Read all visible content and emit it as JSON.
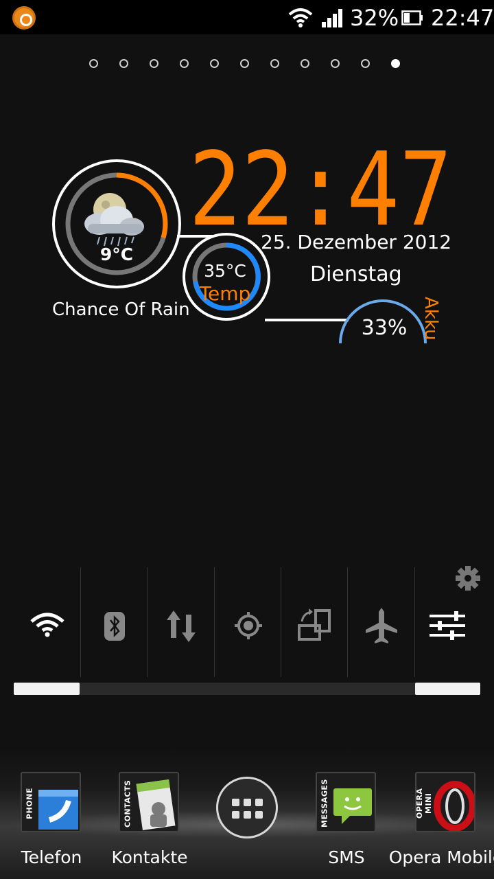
{
  "status_bar": {
    "notification_icon": "opera-notification-icon",
    "wifi_icon": "wifi-icon",
    "signal_icon": "signal-icon",
    "battery_percent": "32%",
    "battery_icon": "battery-icon",
    "time": "22:47"
  },
  "home_pages": {
    "count": 11,
    "active_index": 10
  },
  "clock_widget": {
    "time": "22:47",
    "date": "25. Dezember 2012",
    "day": "Dienstag",
    "accent_color": "#ff8000",
    "weather": {
      "icon": "rain-cloud-moon-icon",
      "temperature": "9°C",
      "condition": "Chance Of Rain"
    },
    "battery_temp": {
      "value": "35°C",
      "label": "Temp"
    },
    "battery": {
      "value": "33%",
      "label": "Akku",
      "level": 0.33
    }
  },
  "power_control": {
    "settings_icon": "gear-icon",
    "toggles": [
      {
        "name": "wifi",
        "icon": "wifi-icon",
        "on": true
      },
      {
        "name": "bluetooth",
        "icon": "bluetooth-icon",
        "on": false
      },
      {
        "name": "mobile-data",
        "icon": "data-arrows-icon",
        "on": false
      },
      {
        "name": "gps",
        "icon": "gps-icon",
        "on": false
      },
      {
        "name": "auto-rotate",
        "icon": "rotate-icon",
        "on": false
      },
      {
        "name": "airplane-mode",
        "icon": "airplane-icon",
        "on": false
      },
      {
        "name": "settings",
        "icon": "sliders-icon",
        "on": true
      }
    ]
  },
  "dock": {
    "apps": [
      {
        "label": "Telefon",
        "tile_text": "PHONE",
        "icon": "phone-icon"
      },
      {
        "label": "Kontakte",
        "tile_text": "CONTACTS",
        "icon": "contacts-icon"
      },
      {
        "label": "SMS",
        "tile_text": "MESSAGES",
        "icon": "messages-icon"
      },
      {
        "label": "Opera Mobile",
        "tile_text": "OPERA MINI",
        "icon": "opera-icon"
      }
    ],
    "launcher_icon": "app-drawer-icon"
  }
}
